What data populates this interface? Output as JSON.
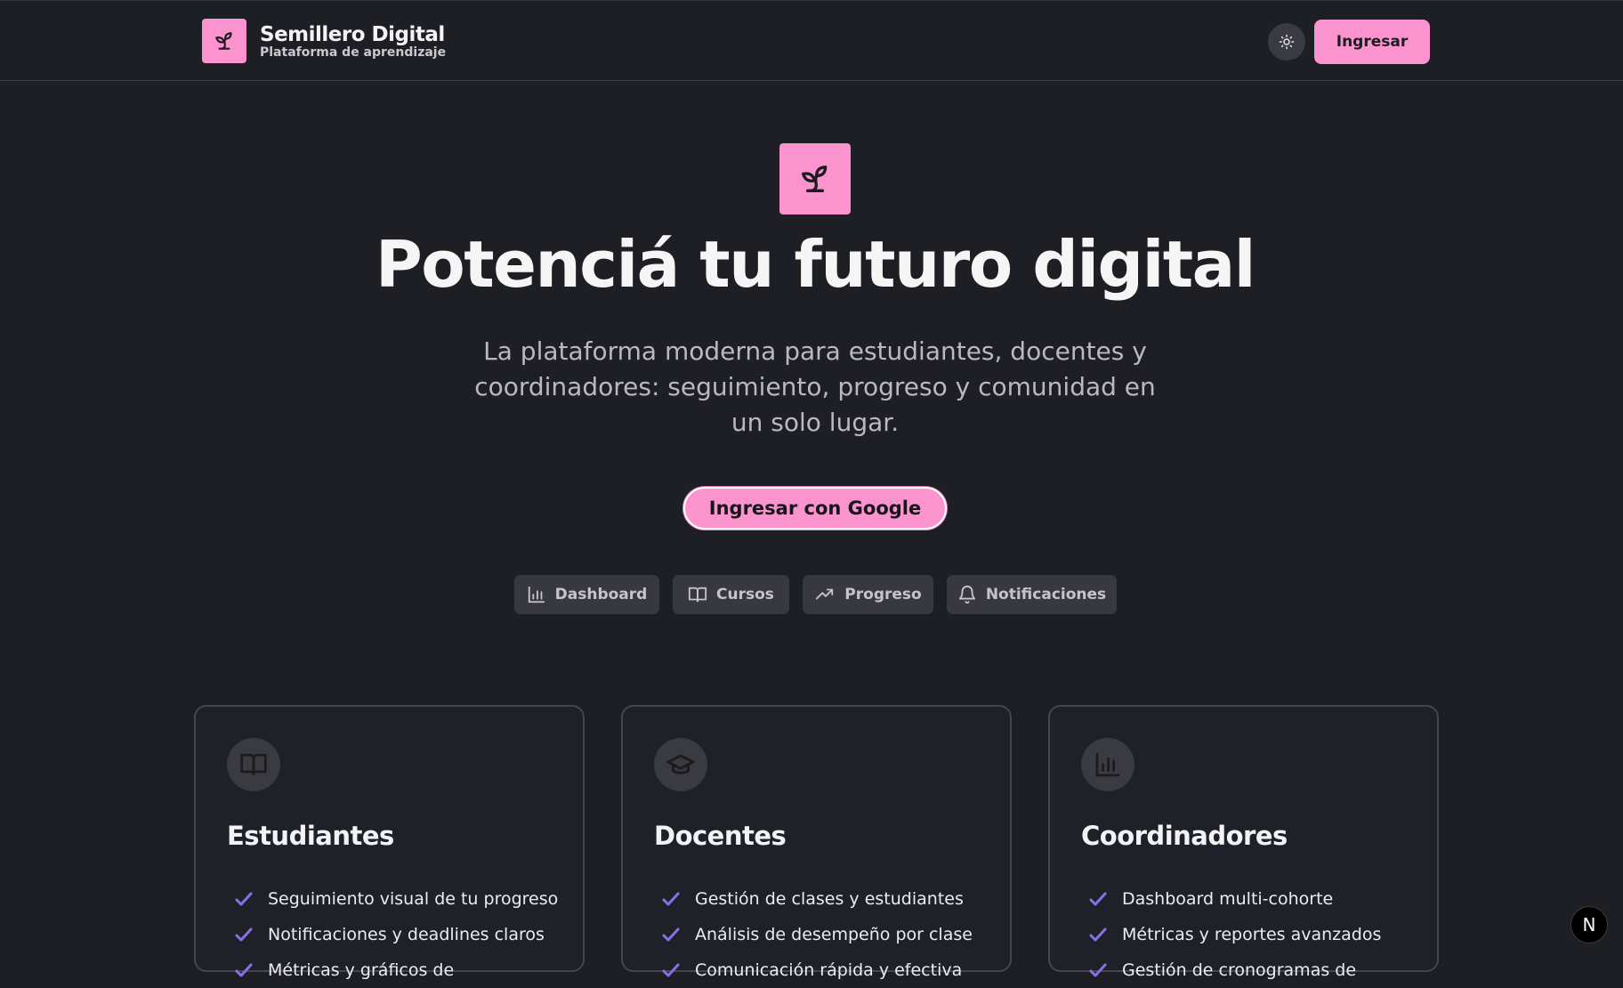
{
  "header": {
    "brand_name": "Semillero Digital",
    "brand_sub": "Plataforma de aprendizaje",
    "login_label": "Ingresar",
    "theme_icon": "sun-icon",
    "logo_icon": "sprout-icon"
  },
  "hero": {
    "title": "Potenciá tu futuro digital",
    "subtitle": "La plataforma moderna para estudiantes, docentes y coordinadores: seguimiento, progreso y comunidad en un solo lugar.",
    "cta_label": "Ingresar con Google"
  },
  "features": [
    {
      "label": "Dashboard",
      "icon": "bar-chart-icon"
    },
    {
      "label": "Cursos",
      "icon": "book-icon"
    },
    {
      "label": "Progreso",
      "icon": "trending-up-icon"
    },
    {
      "label": "Notificaciones",
      "icon": "bell-icon"
    }
  ],
  "cards": [
    {
      "title": "Estudiantes",
      "icon": "book-open-icon",
      "items": [
        "Seguimiento visual de tu progreso",
        "Notificaciones y deadlines claros",
        "Métricas y gráficos de"
      ]
    },
    {
      "title": "Docentes",
      "icon": "graduation-cap-icon",
      "items": [
        "Gestión de clases y estudiantes",
        "Análisis de desempeño por clase",
        "Comunicación rápida y efectiva"
      ]
    },
    {
      "title": "Coordinadores",
      "icon": "bar-chart-icon",
      "items": [
        "Dashboard multi-cohorte",
        "Métricas y reportes avanzados",
        "Gestión de cronogramas de"
      ]
    }
  ],
  "badge": {
    "label": "N"
  },
  "colors": {
    "accent": "#fb93ce",
    "background": "#1d1f25",
    "check": "#8b6ee8"
  }
}
